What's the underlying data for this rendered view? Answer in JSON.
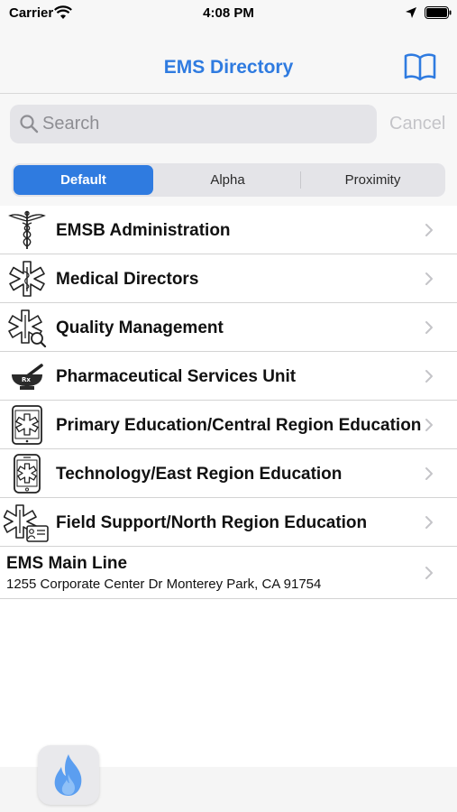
{
  "status": {
    "carrier": "Carrier",
    "time": "4:08 PM"
  },
  "nav": {
    "title": "EMS Directory",
    "book_icon": "book-icon"
  },
  "search": {
    "placeholder": "Search",
    "value": "",
    "cancel": "Cancel"
  },
  "segments": {
    "items": [
      "Default",
      "Alpha",
      "Proximity"
    ],
    "selected": "Default"
  },
  "list": [
    {
      "label": "EMSB Administration",
      "icon": "caduceus-icon"
    },
    {
      "label": "Medical Directors",
      "icon": "star-of-life-icon"
    },
    {
      "label": "Quality Management",
      "icon": "star-of-life-magnifier-icon"
    },
    {
      "label": "Pharmaceutical Services Unit",
      "icon": "mortar-pestle-icon"
    },
    {
      "label": "Primary Education/Central Region Education",
      "icon": "tablet-star-of-life-icon"
    },
    {
      "label": "Technology/East Region Education",
      "icon": "phone-star-of-life-icon"
    },
    {
      "label": "Field Support/North Region Education",
      "icon": "star-of-life-people-icon"
    }
  ],
  "main_line": {
    "title": "EMS Main Line",
    "address": "1255 Corporate Center Dr Monterey Park, CA 91754"
  },
  "colors": {
    "accent": "#2f7be0",
    "flame": "#5b9ef0"
  }
}
